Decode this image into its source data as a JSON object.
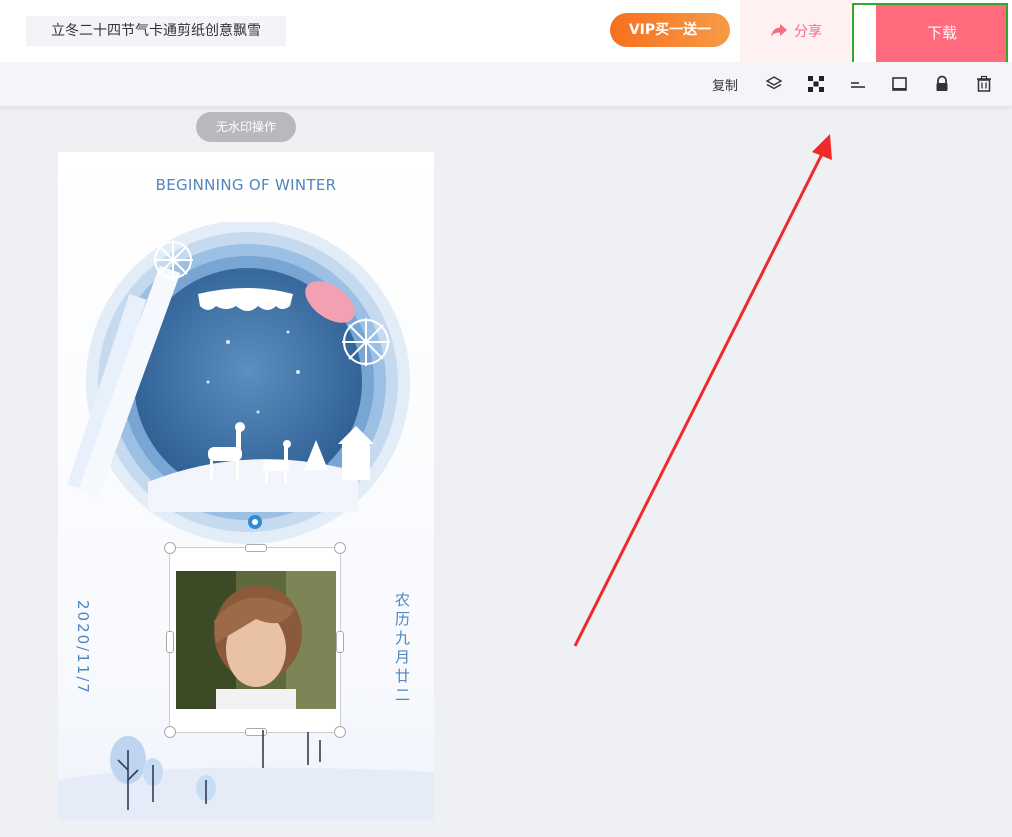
{
  "header": {
    "doc_title": "立冬二十四节气卡通剪纸创意飘雪",
    "vip_label": "VIP买一送一",
    "share_label": "分享",
    "download_label": "下载"
  },
  "toolbar": {
    "copy_label": "复制",
    "icons": [
      "layers-icon",
      "checker-icon",
      "align-icon",
      "crop-icon",
      "lock-icon",
      "trash-icon"
    ]
  },
  "canvas": {
    "nowatermark_label": "无水印操作",
    "card_title": "BEGINNING OF WINTER",
    "date_text": "2020/11/7",
    "lunar_text": "农历九月廿二"
  },
  "colors": {
    "accent_pink": "#ff6a7c",
    "vip_orange": "#f5701f",
    "card_blue": "#4f86bf",
    "highlight_green": "#2faa2f",
    "arrow_red": "#ee2a2a"
  }
}
